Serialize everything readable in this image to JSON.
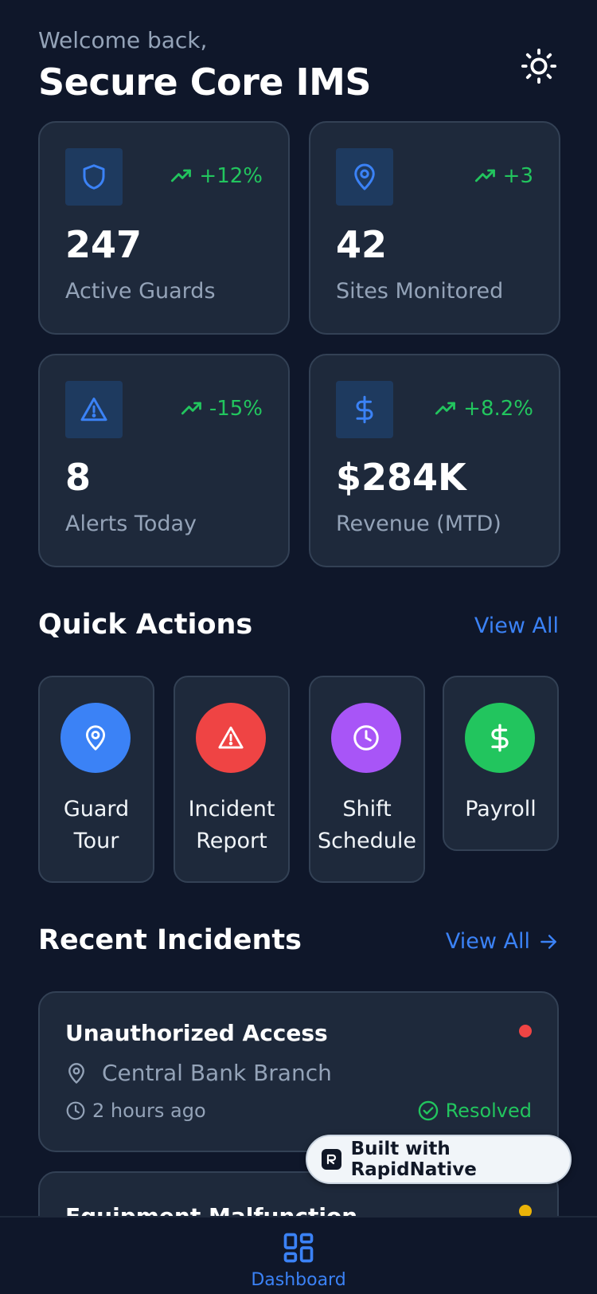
{
  "header": {
    "welcome": "Welcome back,",
    "title": "Secure Core IMS"
  },
  "stats": [
    {
      "icon": "shield-icon",
      "trend": "+12%",
      "value": "247",
      "label": "Active Guards"
    },
    {
      "icon": "map-pin-icon",
      "trend": "+3",
      "value": "42",
      "label": "Sites Monitored"
    },
    {
      "icon": "alert-triangle-icon",
      "trend": "-15%",
      "value": "8",
      "label": "Alerts Today"
    },
    {
      "icon": "dollar-icon",
      "trend": "+8.2%",
      "value": "$284K",
      "label": "Revenue (MTD)"
    }
  ],
  "quick_actions": {
    "title": "Quick Actions",
    "view_all": "View All",
    "items": [
      {
        "icon": "map-pin-icon",
        "label": "Guard Tour",
        "color": "#3b82f6"
      },
      {
        "icon": "alert-triangle-icon",
        "label": "Incident Report",
        "color": "#ef4444"
      },
      {
        "icon": "clock-icon",
        "label": "Shift Schedule",
        "color": "#a855f7"
      },
      {
        "icon": "dollar-icon",
        "label": "Payroll",
        "color": "#22c55e"
      }
    ]
  },
  "recent_incidents": {
    "title": "Recent Incidents",
    "view_all": "View All",
    "items": [
      {
        "title": "Unauthorized Access",
        "location": "Central Bank Branch",
        "time": "2 hours ago",
        "status": "Resolved",
        "dot_color": "#ef4444"
      },
      {
        "title": "Equipment Malfunction",
        "dot_color": "#eab308"
      }
    ]
  },
  "badge": {
    "label": "Built with RapidNative"
  },
  "tab_bar": {
    "active_label": "Dashboard"
  },
  "colors": {
    "background": "#0f172a",
    "card": "#1e293b",
    "accent": "#3b82f6",
    "positive": "#22c55e"
  }
}
